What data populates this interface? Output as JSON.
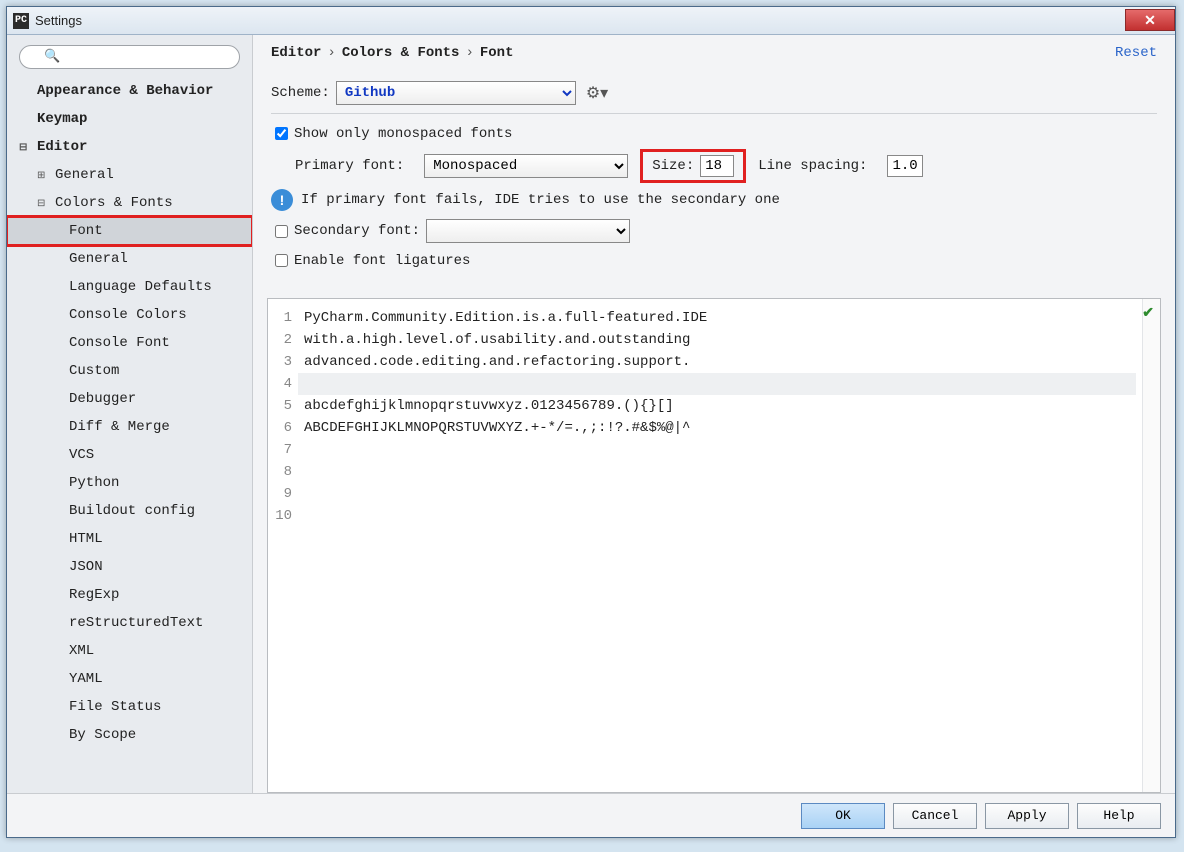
{
  "window": {
    "title": "Settings",
    "app_icon_text": "PC"
  },
  "sidebar": {
    "search_placeholder": "",
    "items": [
      {
        "label": "Appearance & Behavior",
        "level": 1
      },
      {
        "label": "Keymap",
        "level": 1
      },
      {
        "label": "Editor",
        "level": 1,
        "expander": "⊟"
      },
      {
        "label": "General",
        "level": 2,
        "expander": "⊞"
      },
      {
        "label": "Colors & Fonts",
        "level": 2,
        "expander": "⊟"
      },
      {
        "label": "Font",
        "level": 3,
        "selected": true,
        "highlight": true
      },
      {
        "label": "General",
        "level": 3
      },
      {
        "label": "Language Defaults",
        "level": 3
      },
      {
        "label": "Console Colors",
        "level": 3
      },
      {
        "label": "Console Font",
        "level": 3
      },
      {
        "label": "Custom",
        "level": 3
      },
      {
        "label": "Debugger",
        "level": 3
      },
      {
        "label": "Diff & Merge",
        "level": 3
      },
      {
        "label": "VCS",
        "level": 3
      },
      {
        "label": "Python",
        "level": 3
      },
      {
        "label": "Buildout config",
        "level": 3
      },
      {
        "label": "HTML",
        "level": 3
      },
      {
        "label": "JSON",
        "level": 3
      },
      {
        "label": "RegExp",
        "level": 3
      },
      {
        "label": "reStructuredText",
        "level": 3
      },
      {
        "label": "XML",
        "level": 3
      },
      {
        "label": "YAML",
        "level": 3
      },
      {
        "label": "File Status",
        "level": 3
      },
      {
        "label": "By Scope",
        "level": 3
      }
    ]
  },
  "breadcrumbs": {
    "a": "Editor",
    "b": "Colors & Fonts",
    "c": "Font",
    "reset": "Reset"
  },
  "form": {
    "scheme_label": "Scheme:",
    "scheme_value": "Github",
    "show_mono_label": "Show only monospaced fonts",
    "show_mono_checked": true,
    "primary_label": "Primary font:",
    "primary_value": "Monospaced",
    "size_label": "Size:",
    "size_value": "18",
    "line_spacing_label": "Line spacing:",
    "line_spacing_value": "1.0",
    "info_text": "If primary font fails, IDE tries to use the secondary one",
    "secondary_label": "Secondary font:",
    "secondary_checked": false,
    "secondary_value": "",
    "ligatures_label": "Enable font ligatures",
    "ligatures_checked": false
  },
  "preview": {
    "lines": [
      "PyCharm.Community.Edition.is.a.full-featured.IDE",
      "with.a.high.level.of.usability.and.outstanding",
      "advanced.code.editing.and.refactoring.support.",
      "",
      "abcdefghijklmnopqrstuvwxyz.0123456789.(){}[]",
      "ABCDEFGHIJKLMNOPQRSTUVWXYZ.+-*/=.,;:!?.#&$%@|^",
      "",
      "",
      "",
      ""
    ],
    "numbers": [
      "1",
      "2",
      "3",
      "4",
      "5",
      "6",
      "7",
      "8",
      "9",
      "10"
    ]
  },
  "buttons": {
    "ok": "OK",
    "cancel": "Cancel",
    "apply": "Apply",
    "help": "Help"
  }
}
